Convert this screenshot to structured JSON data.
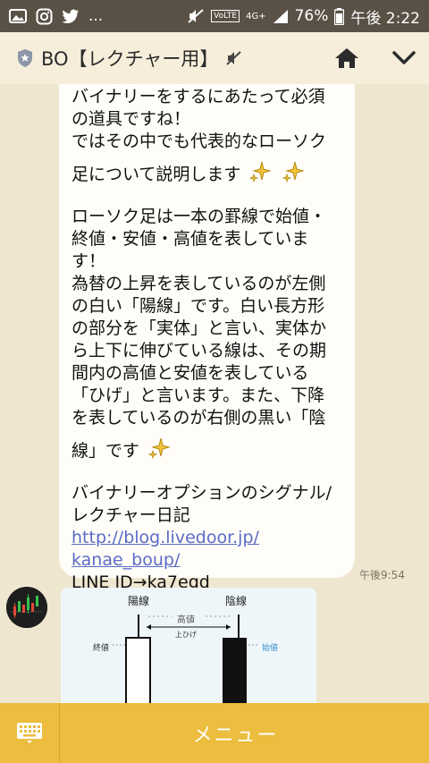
{
  "status_bar": {
    "icons_left": [
      "image-icon",
      "instagram-icon",
      "twitter-icon"
    ],
    "more": "...",
    "volte": "VoLTE",
    "network": "4G+",
    "battery": "76%",
    "time": "午後 2:22"
  },
  "header": {
    "title": "BO【レクチャー用】",
    "icons": [
      "shield-star-icon",
      "mute-icon",
      "home-icon",
      "chevron-down-icon"
    ]
  },
  "message": {
    "lines": [
      "バイナリーをするにあたって必須",
      "の道具ですね！",
      "ではその中でも代表的なローソク",
      "足について説明します",
      "",
      "ローソク足は一本の罫線で始値・",
      "終値・安値・高値を表していま",
      "す！",
      "為替の上昇を表しているのが左側",
      "の白い「陽線」です。白い長方形",
      "の部分を「実体」と言い、実体か",
      "ら上下に伸びている線は、その期",
      "間内の高値と安値を表している",
      "「ひげ」と言います。また、下降",
      "を表しているのが右側の黒い「陰",
      "線」です",
      "",
      "バイナリーオプションのシグナル/",
      "レクチャー日記"
    ],
    "link_line1": "http://blog.livedoor.jp/",
    "link_line2": "kanae_boup/",
    "line_id": "LINE ID→ka7egd",
    "time": "午後9:54"
  },
  "image_card": {
    "label_yang": "陽線",
    "label_yin": "陰線",
    "label_high": "高値",
    "label_upper_wick": "上ひげ",
    "label_close": "終値",
    "label_open": "始値"
  },
  "bottom_bar": {
    "menu_label": "メニュー"
  },
  "colors": {
    "header_bg": "#f6eedb",
    "chat_bg": "#efe6cf",
    "bottom_bar": "#ecbd3e",
    "link": "#5b6bc7"
  }
}
